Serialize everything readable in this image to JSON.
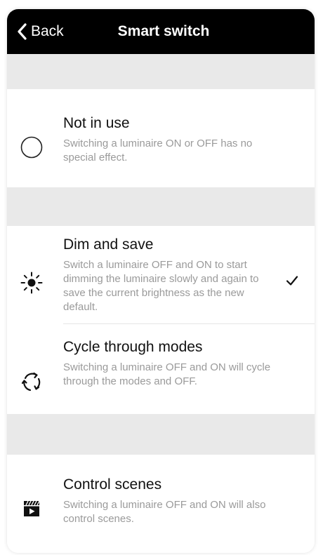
{
  "navbar": {
    "back_label": "Back",
    "title": "Smart switch"
  },
  "options": [
    {
      "title": "Not in use",
      "description": "Switching a luminaire ON or OFF has no special effect.",
      "icon": "circle-outline-icon",
      "selected": false
    },
    {
      "title": "Dim and save",
      "description": "Switch a luminaire OFF and ON to start dimming the luminaire slowly and again to save the current brightness as the new default.",
      "icon": "brightness-icon",
      "selected": true
    },
    {
      "title": "Cycle through modes",
      "description": "Switching a luminaire OFF and ON will cycle through the modes and OFF.",
      "icon": "cycle-icon",
      "selected": false
    },
    {
      "title": "Control scenes",
      "description": "Switching a luminaire OFF and ON will also control scenes.",
      "icon": "clapperboard-icon",
      "selected": false
    }
  ],
  "colors": {
    "navbar_bg": "#000000",
    "section_gap": "#e9e9e9",
    "description_text": "#9a9a9a"
  }
}
